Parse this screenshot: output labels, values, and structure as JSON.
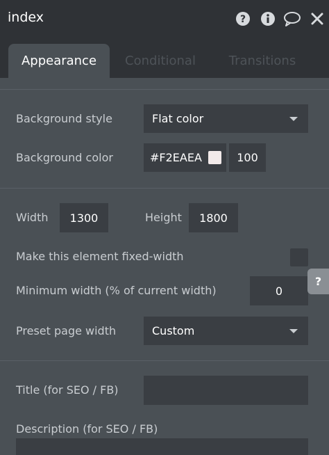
{
  "window": {
    "title": "index",
    "icons": [
      "help-icon",
      "info-icon",
      "comment-icon",
      "close-icon"
    ]
  },
  "tabs": [
    {
      "label": "Appearance",
      "active": true
    },
    {
      "label": "Conditional",
      "active": false
    },
    {
      "label": "Transitions",
      "active": false
    }
  ],
  "appearance": {
    "background_style": {
      "label": "Background style",
      "value": "Flat color"
    },
    "background_color": {
      "label": "Background color",
      "hex": "#F2EAEA",
      "opacity": "100",
      "swatch": "#f2eaea"
    },
    "width": {
      "label": "Width",
      "value": "1300"
    },
    "height": {
      "label": "Height",
      "value": "1800"
    },
    "fixed_width": {
      "label": "Make this element fixed-width",
      "checked": false
    },
    "min_width": {
      "label": "Minimum width (% of current width)",
      "value": "0"
    },
    "preset_width": {
      "label": "Preset page width",
      "value": "Custom"
    },
    "seo_title": {
      "label": "Title (for SEO / FB)",
      "value": ""
    },
    "seo_description": {
      "label": "Description (for SEO / FB)",
      "value": ""
    }
  },
  "help_tab": {
    "label": "?"
  },
  "colors": {
    "titlebar_bg": "#2f3236",
    "panel_bg": "#4a5055",
    "field_bg": "#3a3e43",
    "inactive_tab_text": "#4e5358"
  }
}
